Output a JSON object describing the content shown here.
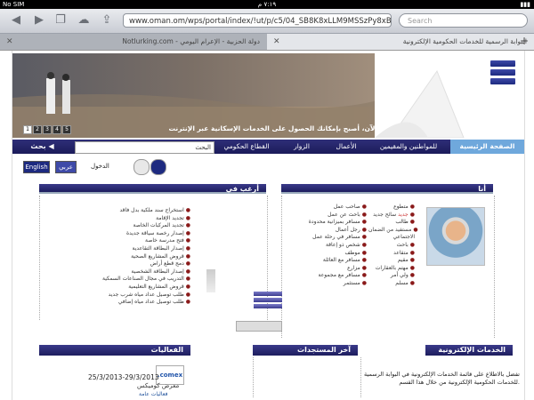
{
  "status_bar": {
    "carrier": "No SIM",
    "time": "٧:١٩ م",
    "battery": "▮▮▮"
  },
  "toolbar": {
    "url": "www.oman.om/wps/portal/index/!ut/p/c5/04_SB8K8xLLM9MSSzPy8xBz",
    "search_placeholder": "Search"
  },
  "tabs": [
    {
      "title": "Notlurking.com - دولة الحزبية - الإعرام اليومي"
    },
    {
      "title": "البوابة الرسمية للخدمات الحكومية الإلكترونية"
    }
  ],
  "banner": {
    "slogan": "الآن، أصبح بإمكانك الحصول على الخدمات الإسكانية عبر الإنترنت",
    "slides": [
      "1",
      "2",
      "3",
      "4",
      "5"
    ]
  },
  "nav": {
    "items": [
      "الصفحة الرئيسية",
      "للمواطنين والمقيمين",
      "الأعمال",
      "الزوار",
      "القطاع الحكومي"
    ],
    "search_label": "البحث",
    "search_button": "بحث"
  },
  "lang": {
    "login": "الدخول",
    "arabic": "عربي",
    "english": "English"
  },
  "sections": {
    "i_am": {
      "title": "أنا",
      "col1": [
        "متطوع",
        "سائح جديد",
        "طالب",
        "مستفيد من الضمان",
        "الاجتماعي",
        "باحث",
        "متقاعد",
        "مقيم",
        "مهتم بالعقارات",
        "ولي أمر",
        "مسلم"
      ],
      "col2": [
        "صاحب عمل",
        "باحث عن عمل",
        "مسافر بميزانية محدودة",
        "رجل أعمال",
        "مسافر في رحلة عمل",
        "شخص ذو إعاقة",
        "موظف",
        "مسافر مع العائلة",
        "مزارع",
        "مسافر مع مجموعة",
        "مستثمر"
      ],
      "new_tag": "جديد"
    },
    "i_want": {
      "title": "أرغب في",
      "items": [
        "استخراج سند ملكية بدل فاقد",
        "تجديد الإقامة",
        "تجديد المركبات الخاصة",
        "إصدار رخصة سياقة جديدة",
        "فتح مدرسة خاصة",
        "إصدار البطاقة التقاعدية",
        "قروض المشاريع الصحية",
        "دمج قطع أراض",
        "إصدار البطاقة الشخصية",
        "التدريب في مجال الصناعات السمكية",
        "قروض المشاريع التعليمية",
        "طلب توصيل عداد مياه شرب جديد",
        "طلب توصيل عداد مياه إضافي"
      ]
    }
  },
  "bottom": {
    "eservices_title": "الخدمات الإلكترونية",
    "eservices_text": "تفضل بالاطلاع على قائمة الخدمات الإلكترونية في البوابة الرسمية للخدمات الحكومية الإلكترونية من خلال هذا القسم.",
    "latest_title": "آخر المستجدات",
    "events_title": "الفعاليات",
    "event_date": "25/3/2013-29/3/2013",
    "event_name": "معرض كوميكس",
    "event_link": "فعاليات عامة",
    "event_logo": ".comex"
  }
}
